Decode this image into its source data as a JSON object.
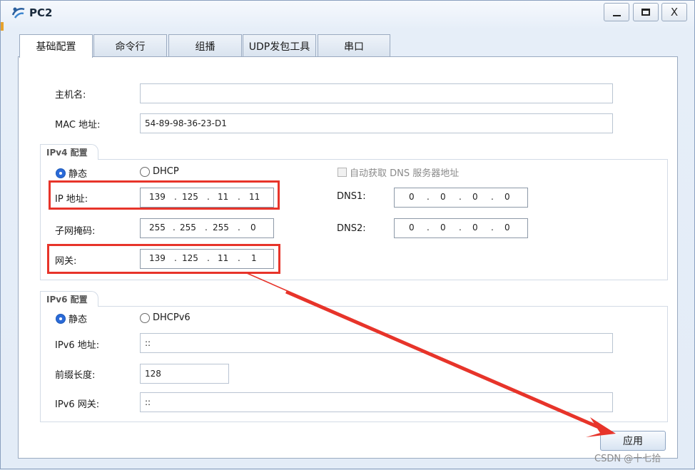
{
  "window": {
    "title": "PC2",
    "minimize": "–",
    "maximize": "□",
    "close": "X"
  },
  "tabs": [
    {
      "label": "基础配置"
    },
    {
      "label": "命令行"
    },
    {
      "label": "组播"
    },
    {
      "label": "UDP发包工具"
    },
    {
      "label": "串口"
    }
  ],
  "basic": {
    "hostname_label": "主机名:",
    "hostname_value": "",
    "mac_label": "MAC 地址:",
    "mac_value": "54-89-98-36-23-D1"
  },
  "ipv4": {
    "group_title": "IPv4 配置",
    "static_label": "静态",
    "dhcp_label": "DHCP",
    "auto_dns_label": "自动获取 DNS 服务器地址",
    "ip_label": "IP 地址:",
    "ip": [
      "139",
      "125",
      "11",
      "11"
    ],
    "mask_label": "子网掩码:",
    "mask": [
      "255",
      "255",
      "255",
      "0"
    ],
    "gateway_label": "网关:",
    "gateway": [
      "139",
      "125",
      "11",
      "1"
    ],
    "dns1_label": "DNS1:",
    "dns1": [
      "0",
      "0",
      "0",
      "0"
    ],
    "dns2_label": "DNS2:",
    "dns2": [
      "0",
      "0",
      "0",
      "0"
    ],
    "static_selected": true
  },
  "ipv6": {
    "group_title": "IPv6 配置",
    "static_label": "静态",
    "dhcp_label": "DHCPv6",
    "addr_label": "IPv6 地址:",
    "addr_value": "::",
    "prefix_label": "前缀长度:",
    "prefix_value": "128",
    "gateway_label": "IPv6 网关:",
    "gateway_value": "::",
    "static_selected": true
  },
  "apply_label": "应用",
  "watermark": "CSDN @十七拾",
  "colors": {
    "highlight": "#e7342a",
    "radio_on": "#2b6ad8"
  }
}
